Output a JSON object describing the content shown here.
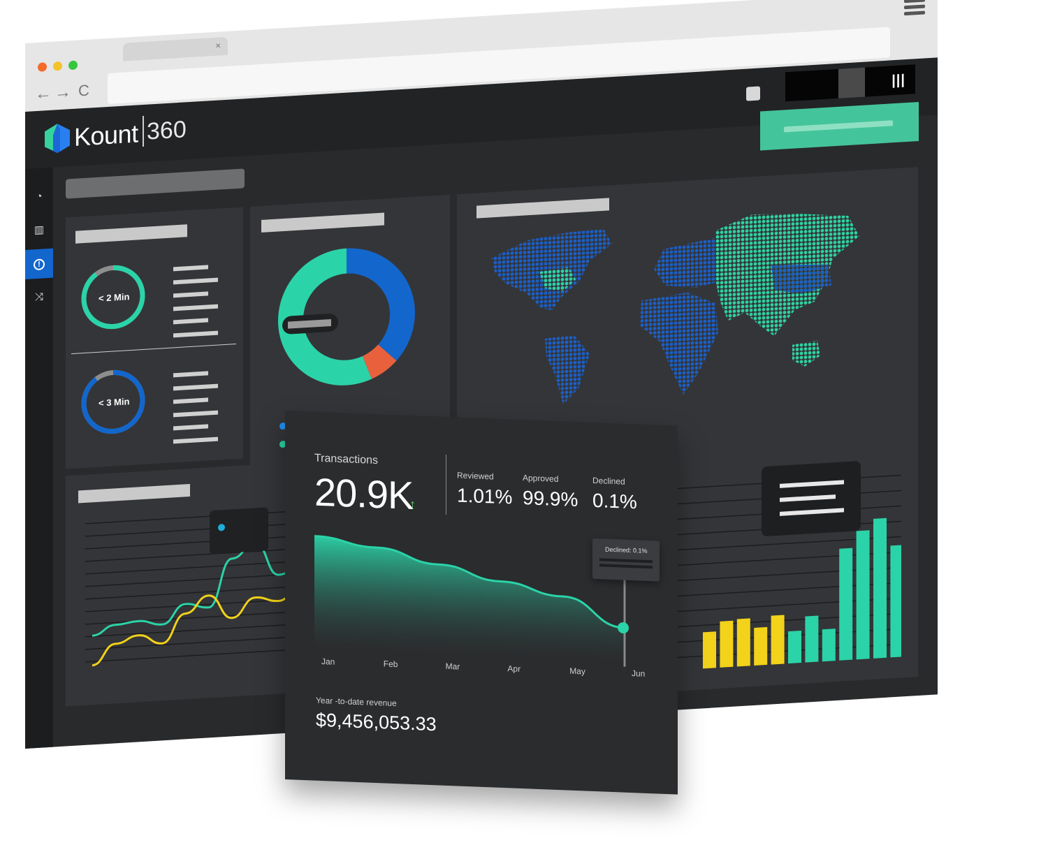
{
  "app": {
    "logo_text": "Kount",
    "logo_reg": "®",
    "logo_suffix": "360",
    "header_menu_glyph": "|||"
  },
  "browser": {
    "tab_close": "×",
    "nav": {
      "back": "←",
      "forward": "→",
      "reload": "C"
    }
  },
  "sidebar": {
    "items": [
      {
        "icon": "dashboard-gauge-icon",
        "glyph": "◔"
      },
      {
        "icon": "bar-chart-icon",
        "glyph": "▥"
      },
      {
        "icon": "alert-icon",
        "glyph": "!"
      },
      {
        "icon": "shuffle-icon",
        "glyph": "⤨"
      }
    ]
  },
  "gauges": [
    {
      "label": "< 2 Min",
      "fraction": 0.9,
      "color": "#2bd3a8"
    },
    {
      "label": "< 3 Min",
      "fraction": 0.9,
      "color": "#1366cc"
    }
  ],
  "transactions": {
    "label": "Transactions",
    "value": "20.9K",
    "trend_icon": "↑",
    "stats": [
      {
        "label": "Reviewed",
        "value": "1.01%"
      },
      {
        "label": "Approved",
        "value": "99.9%"
      },
      {
        "label": "Declined",
        "value": "0.1%"
      }
    ],
    "tooltip": "Declined: 0.1%",
    "ytd_label": "Year -to-date revenue",
    "ytd_value": "$9,456,053.33"
  },
  "chart_data": [
    {
      "type": "pie",
      "labels": [],
      "values": [
        37,
        7,
        56
      ],
      "colors": [
        "#1366cc",
        "#e8613c",
        "#2bd3a8"
      ]
    },
    {
      "type": "area",
      "x": [
        "Jan",
        "Feb",
        "Mar",
        "Apr",
        "May",
        "Jun"
      ],
      "values": [
        100,
        90,
        74,
        58,
        44,
        12
      ],
      "color": "#2bd3a8"
    },
    {
      "type": "line",
      "x": [
        1,
        2,
        3,
        4,
        5,
        6,
        7,
        8,
        9,
        10
      ],
      "series": [
        {
          "values": [
            30,
            38,
            40,
            36,
            52,
            48,
            88,
            100,
            72,
            78
          ],
          "color": "#2bd3a8"
        },
        {
          "values": [
            5,
            22,
            28,
            20,
            44,
            58,
            38,
            54,
            50,
            62
          ],
          "color": "#f2d21a"
        }
      ]
    },
    {
      "type": "bar",
      "values": [
        26,
        33,
        34,
        27,
        35,
        23,
        33,
        23,
        80,
        92,
        100,
        80
      ],
      "colors": [
        "#f2d21a",
        "#f2d21a",
        "#f2d21a",
        "#f2d21a",
        "#f2d21a",
        "#2bd3a8",
        "#2bd3a8",
        "#2bd3a8",
        "#2bd3a8",
        "#2bd3a8",
        "#2bd3a8",
        "#2bd3a8"
      ]
    }
  ]
}
